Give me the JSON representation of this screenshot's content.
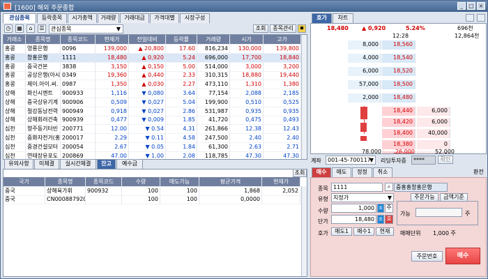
{
  "window": {
    "title": "[1600] 해외 주문종합",
    "buttons": [
      "_",
      "□",
      "×"
    ]
  },
  "topTabs": [
    "관심종목",
    "등락종목",
    "시가총액",
    "거래량",
    "거래대금",
    "가격대별",
    "시장구성"
  ],
  "toolbar": {
    "group": "관심종목",
    "viewBtn": "조회",
    "manageBtn": "종목관리"
  },
  "watchTable": {
    "headers": [
      "거래소",
      "종목명",
      "종목코드",
      "현재가",
      "전일대비",
      "등락률",
      "거래량",
      "시가",
      "고가"
    ],
    "rows": [
      [
        "홍콩",
        "영룡은행",
        "0096",
        "139,000",
        "▲",
        "20,800",
        "17.60",
        "816,234",
        "130,000",
        "139,800",
        "up"
      ],
      [
        "홍콩",
        "창홍은행",
        "1111",
        "18,480",
        "▲",
        "0,920",
        "5.24",
        "696,000",
        "17,700",
        "18,840",
        "up"
      ],
      [
        "홍콩",
        "중국건본",
        "3838",
        "3,150",
        "▲",
        "0,150",
        "5.00",
        "514,000",
        "3,000",
        "3,200",
        "up"
      ],
      [
        "홍콩",
        "공상은행(아시",
        "0349",
        "19,360",
        "▲",
        "0,440",
        "2.33",
        "310,315",
        "18,880",
        "19,440",
        "up"
      ],
      [
        "홍콩",
        "제이.아이.씨.",
        "0987",
        "1,350",
        "▲",
        "0,030",
        "2.27",
        "473,110",
        "1,310",
        "1,380",
        "up"
      ],
      [
        "상해",
        "화신시멘트",
        "900933",
        "1,116",
        "▼",
        "0,080",
        "3.64",
        "77,154",
        "2,088",
        "2,185",
        "down"
      ],
      [
        "상해",
        "중국상유기계",
        "900906",
        "0,509",
        "▼",
        "0,027",
        "5.04",
        "199,900",
        "0,510",
        "0,525",
        "down"
      ],
      [
        "상해",
        "절강동남전력",
        "900949",
        "0,918",
        "▼",
        "0,027",
        "2.86",
        "531,987",
        "0,935",
        "0,935",
        "down"
      ],
      [
        "상해",
        "상해회려건축",
        "900939",
        "0,477",
        "▼",
        "0,009",
        "1.85",
        "41,720",
        "0,475",
        "0,493",
        "down"
      ],
      [
        "심천",
        "향주동기터빈",
        "200771",
        "12.00",
        "▼",
        "0.54",
        "4.31",
        "261,866",
        "12.38",
        "12.43",
        "down"
      ],
      [
        "심천",
        "중화자전거(홍",
        "200017",
        "2.29",
        "▼",
        "0.11",
        "4.58",
        "247,500",
        "2.40",
        "2.40",
        "down"
      ],
      [
        "심천",
        "중경건설모터",
        "200054",
        "2.67",
        "▼",
        "0.05",
        "1.84",
        "61,300",
        "2.63",
        "2.71",
        "down"
      ],
      [
        "심천",
        "연태장유포도",
        "200869",
        "47.00",
        "▼",
        "1.00",
        "2.08",
        "118,785",
        "47.30",
        "47.30",
        "down"
      ]
    ]
  },
  "rightTop": {
    "tabs": [
      "호가",
      "차트"
    ],
    "price": "18,480",
    "change": "▲ 0,920",
    "rate": "5.24%",
    "volume": "696천",
    "time": "12:28",
    "sumVolume": "12,864천",
    "asks": [
      {
        "qty": "8,000",
        "price": "18,560"
      },
      {
        "qty": "4,000",
        "price": "18,540"
      },
      {
        "qty": "6,000",
        "price": "18,520"
      },
      {
        "qty": "57,000",
        "price": "18,500"
      },
      {
        "qty": "2,000",
        "price": "18,480"
      }
    ],
    "bids": [
      {
        "price": "18,440",
        "qty": "6,000"
      },
      {
        "price": "18,420",
        "qty": "6,000"
      },
      {
        "price": "18,400",
        "qty": "40,000"
      },
      {
        "price": "18,380",
        "qty": "0"
      },
      {
        "price": "18,360",
        "qty": "0"
      }
    ],
    "totals": [
      "78,000",
      "26,000",
      "52,000"
    ]
  },
  "bottomTabs": [
    "유의사항",
    "미체결",
    "실시간체결",
    "잔고",
    "예수금"
  ],
  "balanceTable": {
    "viewBtn": "조회",
    "headers": [
      "국가",
      "종목명",
      "종목코드",
      "수량",
      "매도가능",
      "평균가격",
      "현재가"
    ],
    "rows": [
      [
        "중국",
        "상해육가휘",
        "900932",
        "100",
        "100",
        "1,868",
        "2,052"
      ],
      [
        "중국",
        "CN000887920",
        "",
        "100",
        "100",
        "0,0000",
        ""
      ]
    ]
  },
  "order": {
    "account": "001-45-700117",
    "accountName": "리딩투자증",
    "passwordMask": "****",
    "confirm": "확인",
    "tabs": [
      "매수",
      "매도",
      "정정",
      "취소"
    ],
    "clear": "환전",
    "stockLabel": "종목",
    "stockCode": "1111",
    "stockName": "중홍홍창홍은행",
    "typeLabel": "유형",
    "type": "지정가",
    "qtyLabel": "수량",
    "qty": "1,000",
    "priceLabel": "단가",
    "price": "18,480",
    "hogaLabel": "호가",
    "hogaButtons": [
      "매도1",
      "매수1",
      "현재"
    ],
    "orderableLabel": "주문가능",
    "marginLabel": "금액기준",
    "availableLabel": "가능",
    "unit": "주",
    "sellUnitLabel": "매매단위",
    "sellUnit": "1,000 주",
    "orderNo": "주문번호",
    "buy": "매수"
  }
}
